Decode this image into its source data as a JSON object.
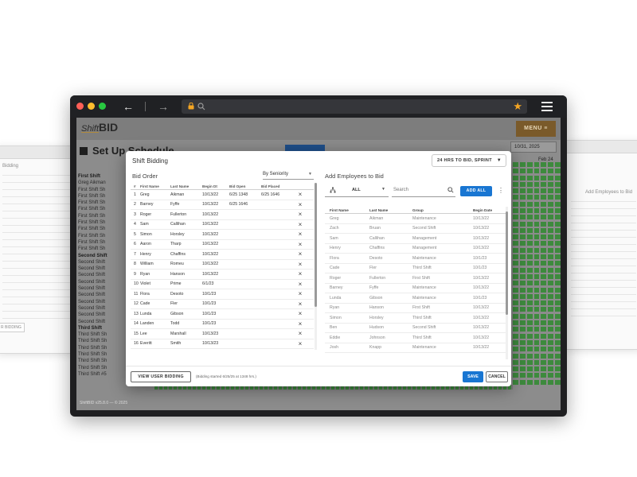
{
  "browser": {
    "icons": [
      "back-arrow-icon",
      "forward-arrow-icon",
      "lock-icon",
      "search-icon",
      "star-icon",
      "hamburger-menu-icon"
    ]
  },
  "app": {
    "logo_prefix": "Shift",
    "logo_suffix": "BID",
    "menu_label": "MENU",
    "page_title": "Set Up Schedule",
    "date_value": "10/31, 2025",
    "feb_label": "Feb 24",
    "footer": "ShiftBID v25.8.0 — © 2025",
    "left_list": [
      {
        "text": "First Shift",
        "group": true
      },
      {
        "text": "Greg Aikman",
        "group": false
      },
      {
        "text": "First Shift Sh",
        "group": false
      },
      {
        "text": "First Shift Sh",
        "group": false
      },
      {
        "text": "First Shift Sh",
        "group": false
      },
      {
        "text": "First Shift Sh",
        "group": false
      },
      {
        "text": "First Shift Sh",
        "group": false
      },
      {
        "text": "First Shift Sh",
        "group": false
      },
      {
        "text": "First Shift Sh",
        "group": false
      },
      {
        "text": "First Shift Sh",
        "group": false
      },
      {
        "text": "First Shift Sh",
        "group": false
      },
      {
        "text": "First Shift Sh",
        "group": false
      },
      {
        "text": "Second Shift",
        "group": true
      },
      {
        "text": "Second Shift",
        "group": false
      },
      {
        "text": "Second Shift",
        "group": false
      },
      {
        "text": "Second Shift",
        "group": false
      },
      {
        "text": "Second Shift",
        "group": false
      },
      {
        "text": "Second Shift",
        "group": false
      },
      {
        "text": "Second Shift",
        "group": false
      },
      {
        "text": "Second Shift",
        "group": false
      },
      {
        "text": "Second Shift",
        "group": false
      },
      {
        "text": "Second Shift",
        "group": false
      },
      {
        "text": "Second Shift",
        "group": false
      },
      {
        "text": "Third Shift",
        "group": true
      },
      {
        "text": "Third Shift Sh",
        "group": false
      },
      {
        "text": "Third Shift Sh",
        "group": false
      },
      {
        "text": "Third Shift Sh",
        "group": false
      },
      {
        "text": "Third Shift Sh",
        "group": false
      },
      {
        "text": "Third Shift Sh",
        "group": false
      },
      {
        "text": "Third Shift Sh",
        "group": false
      },
      {
        "text": "Third Shift #5",
        "group": false
      }
    ],
    "colors": {
      "accent": "#1976d2",
      "schedule_green": "#3d8a3d",
      "menu_brown": "#7a5a2a"
    }
  },
  "dialog": {
    "title": "Shift Bidding",
    "sprint_select": "24 HRS TO BID, SPRINT",
    "bid_order": {
      "label": "Bid Order",
      "sort_select": "By Seniority",
      "headers": {
        "num": "#",
        "first": "First Name",
        "last": "Last Name",
        "begin": "Begin Dt",
        "open": "Bid Open",
        "placed": "Bid Placed"
      },
      "rows": [
        {
          "num": "1",
          "first": "Greg",
          "last": "Aikman",
          "begin": "10/13/22",
          "open": "6/25 1348",
          "placed": "6/25 1646"
        },
        {
          "num": "2",
          "first": "Barney",
          "last": "Fyffe",
          "begin": "10/13/22",
          "open": "6/25 1646",
          "placed": ""
        },
        {
          "num": "3",
          "first": "Roger",
          "last": "Fullerton",
          "begin": "10/13/22",
          "open": "",
          "placed": ""
        },
        {
          "num": "4",
          "first": "Sam",
          "last": "Callihan",
          "begin": "10/13/22",
          "open": "",
          "placed": ""
        },
        {
          "num": "5",
          "first": "Simon",
          "last": "Horsley",
          "begin": "10/13/22",
          "open": "",
          "placed": ""
        },
        {
          "num": "6",
          "first": "Aaron",
          "last": "Tharp",
          "begin": "10/13/22",
          "open": "",
          "placed": ""
        },
        {
          "num": "7",
          "first": "Henry",
          "last": "Chaffins",
          "begin": "10/13/22",
          "open": "",
          "placed": ""
        },
        {
          "num": "8",
          "first": "William",
          "last": "Romeu",
          "begin": "10/13/22",
          "open": "",
          "placed": ""
        },
        {
          "num": "9",
          "first": "Ryan",
          "last": "Hanson",
          "begin": "10/13/22",
          "open": "",
          "placed": ""
        },
        {
          "num": "10",
          "first": "Violet",
          "last": "Prime",
          "begin": "6/1/23",
          "open": "",
          "placed": ""
        },
        {
          "num": "11",
          "first": "Flora",
          "last": "Desoto",
          "begin": "10/1/23",
          "open": "",
          "placed": ""
        },
        {
          "num": "12",
          "first": "Cade",
          "last": "Fler",
          "begin": "10/1/23",
          "open": "",
          "placed": ""
        },
        {
          "num": "13",
          "first": "Lunda",
          "last": "Gibson",
          "begin": "10/1/23",
          "open": "",
          "placed": ""
        },
        {
          "num": "14",
          "first": "Landen",
          "last": "Todd",
          "begin": "10/1/23",
          "open": "",
          "placed": ""
        },
        {
          "num": "15",
          "first": "Lee",
          "last": "Marshall",
          "begin": "10/13/23",
          "open": "",
          "placed": ""
        },
        {
          "num": "16",
          "first": "Everitt",
          "last": "Smith",
          "begin": "10/13/23",
          "open": "",
          "placed": ""
        }
      ]
    },
    "add_employees": {
      "label": "Add Employees to Bid",
      "filter_value": "ALL",
      "search_placeholder": "Search",
      "add_all": "ADD ALL",
      "headers": {
        "first": "First Name",
        "last": "Last Name",
        "group": "Group",
        "begin": "Begin Date"
      },
      "rows": [
        {
          "first": "Greg",
          "last": "Aikman",
          "group": "Maintenance",
          "begin": "10/13/22"
        },
        {
          "first": "Zach",
          "last": "Bruan",
          "group": "Second Shift",
          "begin": "10/13/22"
        },
        {
          "first": "Sam",
          "last": "Callihan",
          "group": "Management",
          "begin": "10/13/22"
        },
        {
          "first": "Henry",
          "last": "Chaffins",
          "group": "Management",
          "begin": "10/13/22"
        },
        {
          "first": "Flora",
          "last": "Desoto",
          "group": "Maintenance",
          "begin": "10/1/23"
        },
        {
          "first": "Cade",
          "last": "Fler",
          "group": "Third Shift",
          "begin": "10/1/23"
        },
        {
          "first": "Roger",
          "last": "Fullerton",
          "group": "First Shift",
          "begin": "10/13/22"
        },
        {
          "first": "Barney",
          "last": "Fyffe",
          "group": "Maintenance",
          "begin": "10/13/22"
        },
        {
          "first": "Lunda",
          "last": "Gibson",
          "group": "Maintenance",
          "begin": "10/1/23"
        },
        {
          "first": "Ryan",
          "last": "Hanson",
          "group": "First Shift",
          "begin": "10/13/22"
        },
        {
          "first": "Simon",
          "last": "Horsley",
          "group": "Third Shift",
          "begin": "10/13/22"
        },
        {
          "first": "Ben",
          "last": "Hudson",
          "group": "Second Shift",
          "begin": "10/13/22"
        },
        {
          "first": "Eddie",
          "last": "Johnson",
          "group": "Third Shift",
          "begin": "10/13/22"
        },
        {
          "first": "Josh",
          "last": "Knapp",
          "group": "Maintenance",
          "begin": "10/13/22"
        }
      ]
    },
    "footer": {
      "view_user_bidding": "VIEW USER BIDDING",
      "note": "(Bidding started 6/25/25 at 1348 hrs.)",
      "save": "SAVE",
      "cancel": "CANCEL"
    }
  },
  "ghost_left": {
    "title": "Bidding",
    "button": "R BIDDING"
  },
  "ghost_right": {
    "title": "Add Employees to Bid"
  }
}
